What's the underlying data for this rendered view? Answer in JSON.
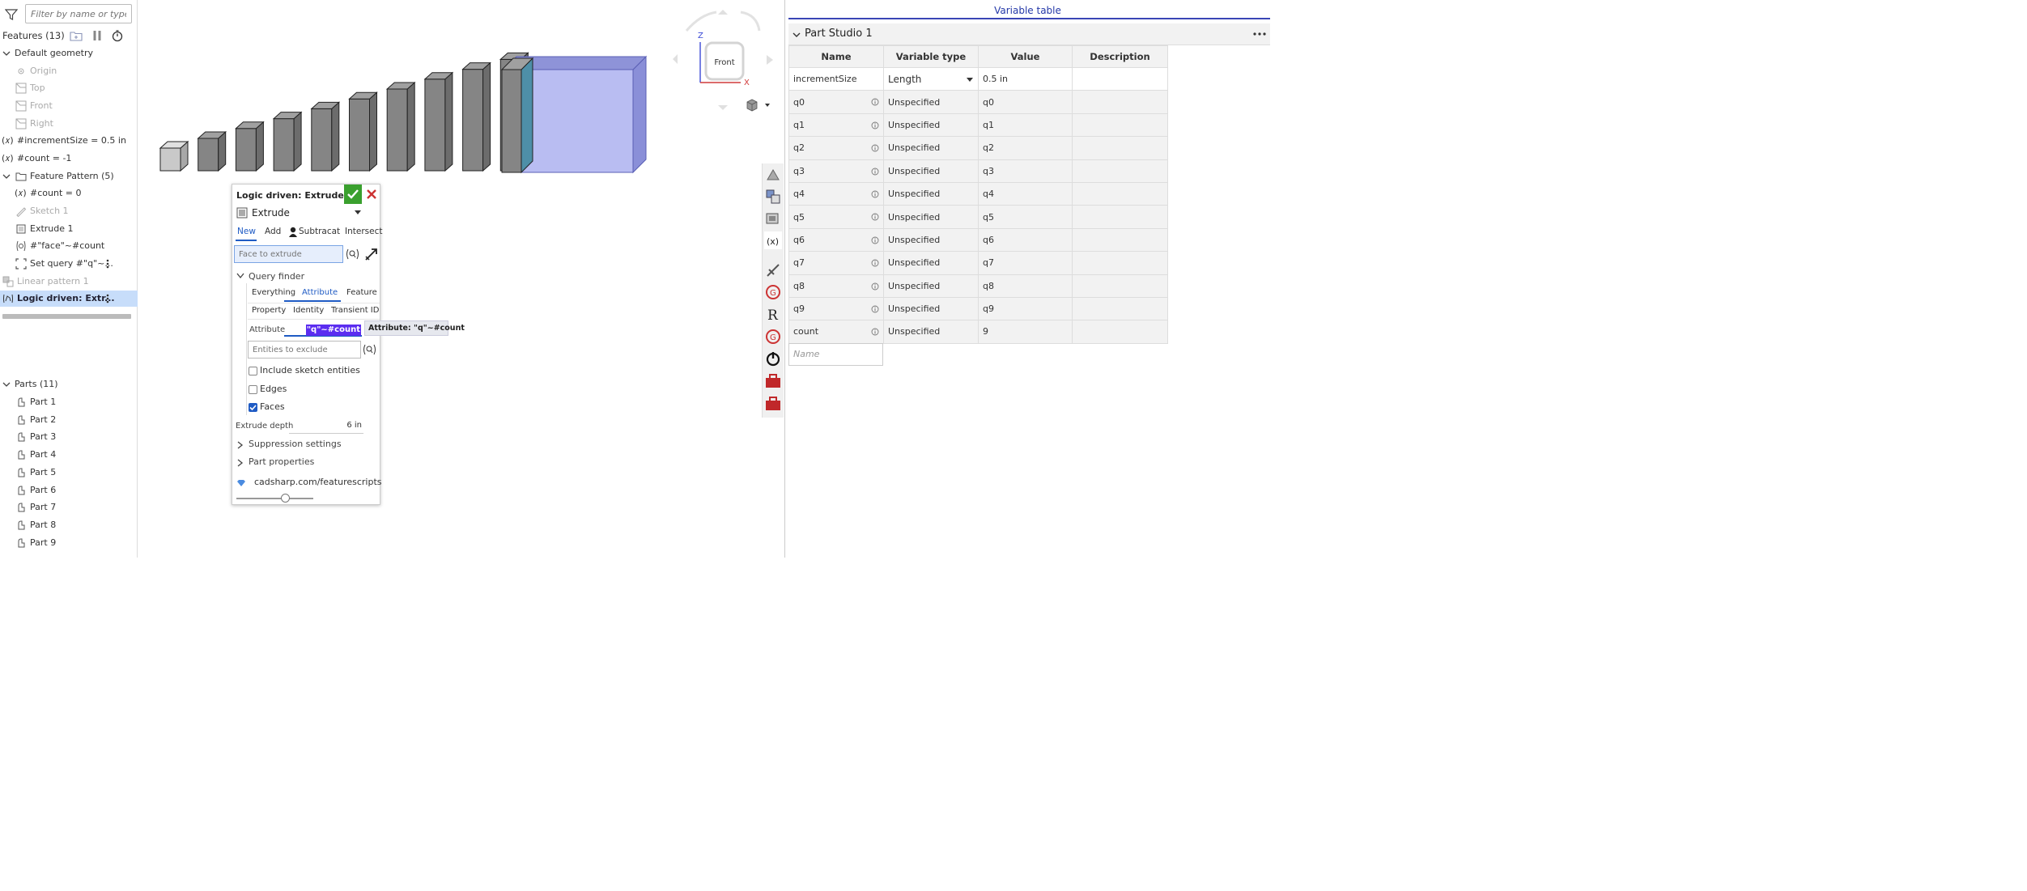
{
  "filter": {
    "placeholder": "Filter by name or type"
  },
  "features": {
    "title": "Features (13)",
    "tree": [
      {
        "label": "Default geometry"
      },
      {
        "label": "Origin"
      },
      {
        "label": "Top"
      },
      {
        "label": "Front"
      },
      {
        "label": "Right"
      },
      {
        "label": "#incrementSize = 0.5 in"
      },
      {
        "label": "#count = -1"
      },
      {
        "label": "Feature Pattern (5)"
      },
      {
        "label": "#count = 0"
      },
      {
        "label": "Sketch 1"
      },
      {
        "label": "Extrude 1"
      },
      {
        "label": "#\"face\"~#count"
      },
      {
        "label": "Set query #\"q\"~..."
      },
      {
        "label": "Linear pattern 1"
      },
      {
        "label": "Logic driven: Extr..."
      }
    ]
  },
  "parts": {
    "title": "Parts (11)",
    "items": [
      "Part 1",
      "Part 2",
      "Part 3",
      "Part 4",
      "Part 5",
      "Part 6",
      "Part 7",
      "Part 8",
      "Part 9"
    ]
  },
  "dialog": {
    "title": "Logic driven: Extrude",
    "feature_type": "Extrude",
    "tabs": [
      "New",
      "Add",
      "Subtract",
      "Intersect"
    ],
    "face_placeholder": "Face to extrude",
    "query_finder": "Query finder",
    "qf_tabs": [
      "Everything",
      "Attribute",
      "Feature",
      "Property",
      "Identity",
      "Transient ID"
    ],
    "attribute_label": "Attribute",
    "attribute_value": "\"q\"~#count",
    "exclude_placeholder": "Entities to exclude",
    "checkboxes": [
      {
        "label": "Include sketch entities",
        "checked": false
      },
      {
        "label": "Edges",
        "checked": false
      },
      {
        "label": "Faces",
        "checked": true
      }
    ],
    "depth_label": "Extrude depth",
    "depth_value": "6 in",
    "suppression": "Suppression settings",
    "part_props": "Part properties",
    "link": "cadsharp.com/featurescripts",
    "slider_fraction": 0.64
  },
  "tooltip": "Attribute: \"q\"~#count",
  "viewcube": {
    "face": "Front",
    "axis_z": "Z",
    "axis_x": "X"
  },
  "variable_table": {
    "title": "Variable table",
    "studio": "Part Studio 1",
    "columns": [
      "Name",
      "Variable type",
      "Value",
      "Description"
    ],
    "rows": [
      {
        "name": "incrementSize",
        "type": "Length",
        "value": "0.5 in",
        "description": ""
      },
      {
        "name": "q0",
        "type": "Unspecified",
        "value": "q0",
        "description": ""
      },
      {
        "name": "q1",
        "type": "Unspecified",
        "value": "q1",
        "description": ""
      },
      {
        "name": "q2",
        "type": "Unspecified",
        "value": "q2",
        "description": ""
      },
      {
        "name": "q3",
        "type": "Unspecified",
        "value": "q3",
        "description": ""
      },
      {
        "name": "q4",
        "type": "Unspecified",
        "value": "q4",
        "description": ""
      },
      {
        "name": "q5",
        "type": "Unspecified",
        "value": "q5",
        "description": ""
      },
      {
        "name": "q6",
        "type": "Unspecified",
        "value": "q6",
        "description": ""
      },
      {
        "name": "q7",
        "type": "Unspecified",
        "value": "q7",
        "description": ""
      },
      {
        "name": "q8",
        "type": "Unspecified",
        "value": "q8",
        "description": ""
      },
      {
        "name": "q9",
        "type": "Unspecified",
        "value": "q9",
        "description": ""
      },
      {
        "name": "count",
        "type": "Unspecified",
        "value": "9",
        "description": ""
      }
    ],
    "name_placeholder": "Name"
  },
  "colors": {
    "accent": "#1f5bc4",
    "ok": "#3aa02e",
    "selection": "#c7ddfa",
    "highlight": "#5b2df0",
    "table_title": "#2438a8"
  }
}
